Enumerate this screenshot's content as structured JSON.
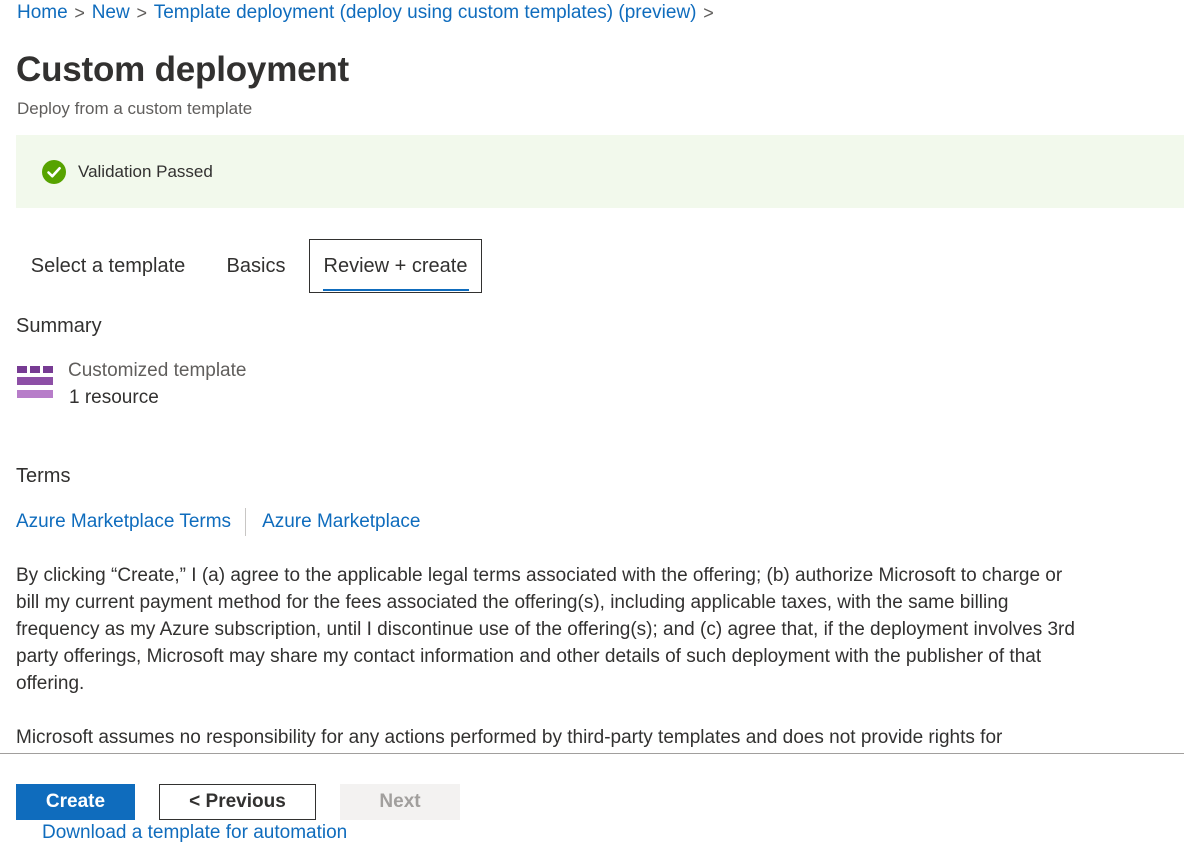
{
  "breadcrumb": {
    "items": [
      "Home",
      "New",
      "Template deployment (deploy using custom templates) (preview)"
    ],
    "separator": ">"
  },
  "header": {
    "title": "Custom deployment",
    "subtitle": "Deploy from a custom template"
  },
  "validation": {
    "text": "Validation Passed",
    "status": "success",
    "icon": "check-circle-icon"
  },
  "tabs": [
    {
      "label": "Select a template",
      "selected": false
    },
    {
      "label": "Basics",
      "selected": false
    },
    {
      "label": "Review + create",
      "selected": true
    }
  ],
  "summary": {
    "heading": "Summary",
    "template_name": "Customized template",
    "resource_count": "1 resource",
    "icon": "template-icon"
  },
  "terms": {
    "heading": "Terms",
    "links": [
      "Azure Marketplace Terms",
      "Azure Marketplace"
    ],
    "paragraph": "By clicking “Create,” I (a) agree to the applicable legal terms associated with the offering; (b) authorize Microsoft to charge or bill my current payment method for the fees associated the offering(s), including applicable taxes, with the same billing frequency as my Azure subscription, until I discontinue use of the offering(s); and (c) agree that, if the deployment involves 3rd party offerings, Microsoft may share my contact information and other details of such deployment with the publisher of that offering.",
    "paragraph2": "Microsoft assumes no responsibility for any actions performed by third-party templates and does not provide rights for"
  },
  "footer": {
    "create_label": "Create",
    "previous_label": "< Previous",
    "next_label": "Next",
    "download_link": "Download a template for automation"
  },
  "colors": {
    "accent": "#0f6cbd",
    "success": "#57a300",
    "banner_bg": "#f2f9ec",
    "template_icon": "#8d4fa6"
  }
}
